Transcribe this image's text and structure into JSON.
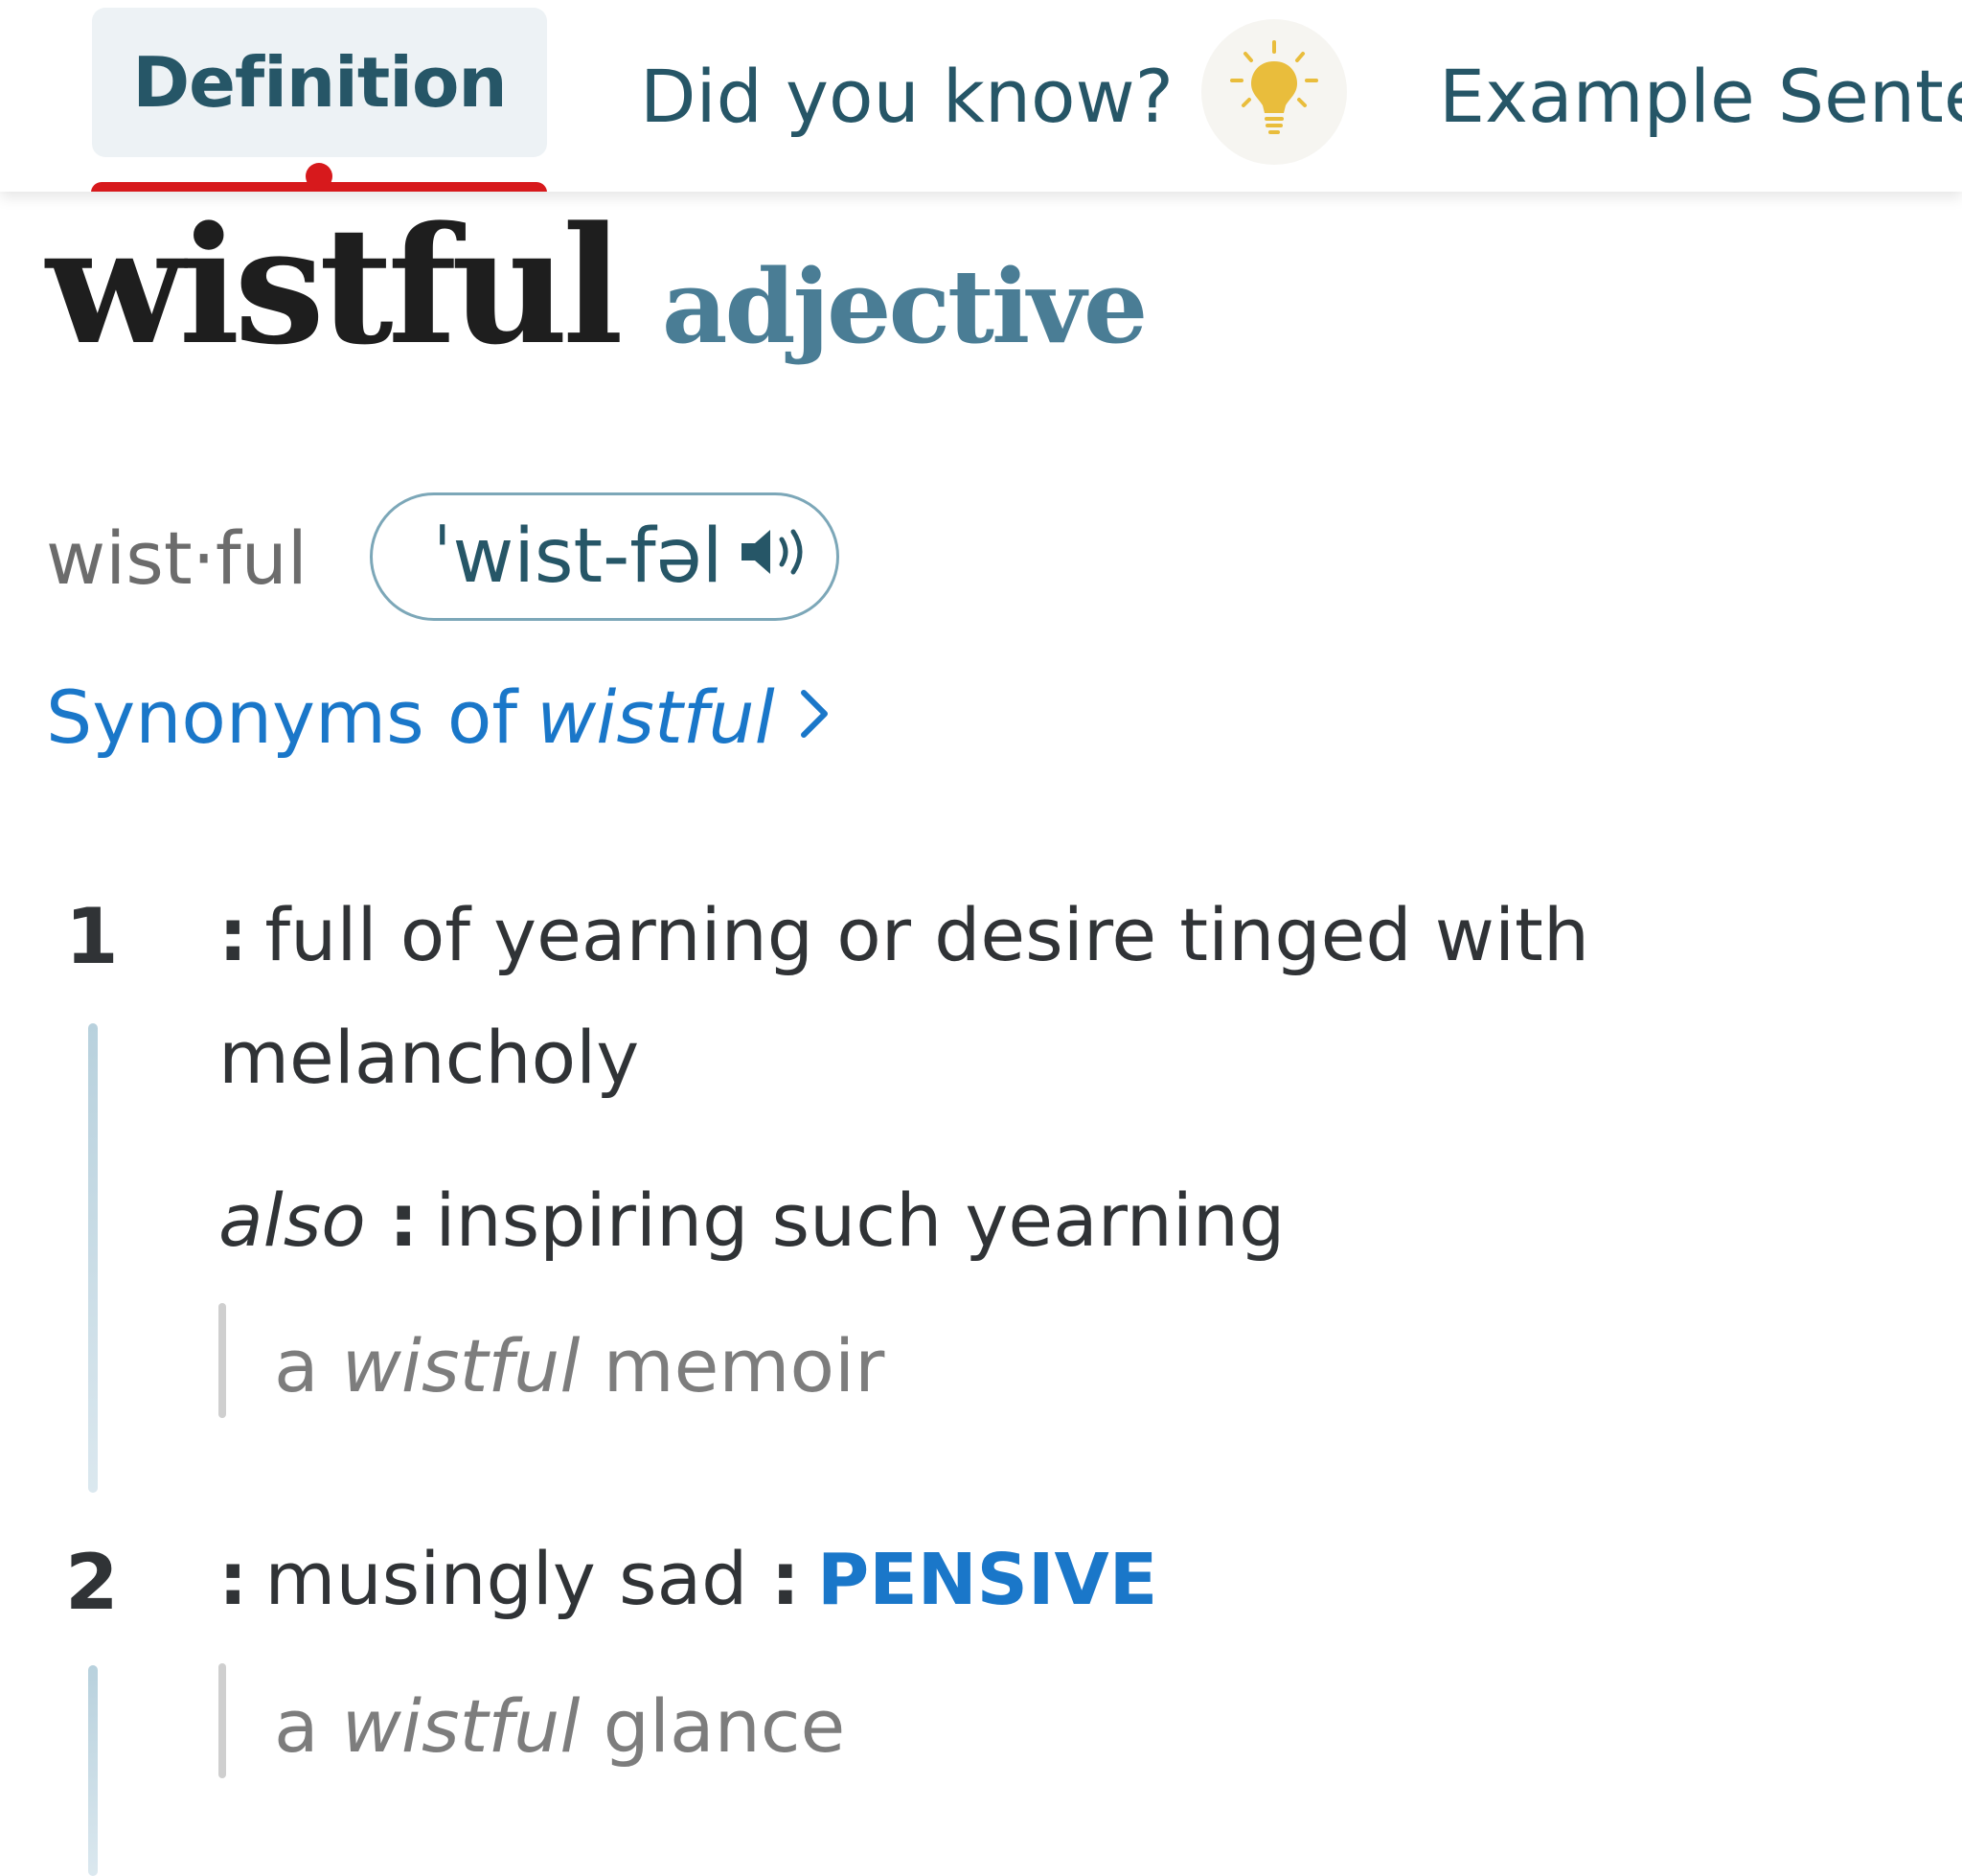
{
  "tabs": {
    "definition_label": "Definition",
    "did_you_know_label": "Did you know?",
    "examples_label": "Example Sente"
  },
  "entry": {
    "headword": "wistful",
    "part_of_speech": "adjective",
    "syllables": "wist·ful",
    "pronunciation": "ˈwist-fəl"
  },
  "synonyms_link": {
    "prefix": "Synonyms of",
    "word": "wistful"
  },
  "senses": [
    {
      "number": "1",
      "colon": ":",
      "definition_line1": "full of yearning or desire tinged with",
      "definition_line2": "melancholy",
      "also_label": "also",
      "also_colon": ":",
      "also_text": "inspiring such yearning",
      "example": {
        "pre": "a",
        "word": "wistful",
        "post": "memoir"
      }
    },
    {
      "number": "2",
      "colon": ":",
      "definition": "musingly sad",
      "link_colon": ":",
      "link_word": "PENSIVE",
      "example": {
        "pre": "a",
        "word": "wistful",
        "post": "glance"
      }
    }
  ],
  "icons": {
    "bulb": "lightbulb-icon",
    "speaker": "speaker-icon",
    "chevron": "chevron-right-icon"
  },
  "colors": {
    "accent_red": "#d7191c",
    "link_blue": "#1a77c9",
    "tab_text": "#265667",
    "pos_color": "#4a7d95",
    "bulb_yellow": "#e9bd3c"
  }
}
